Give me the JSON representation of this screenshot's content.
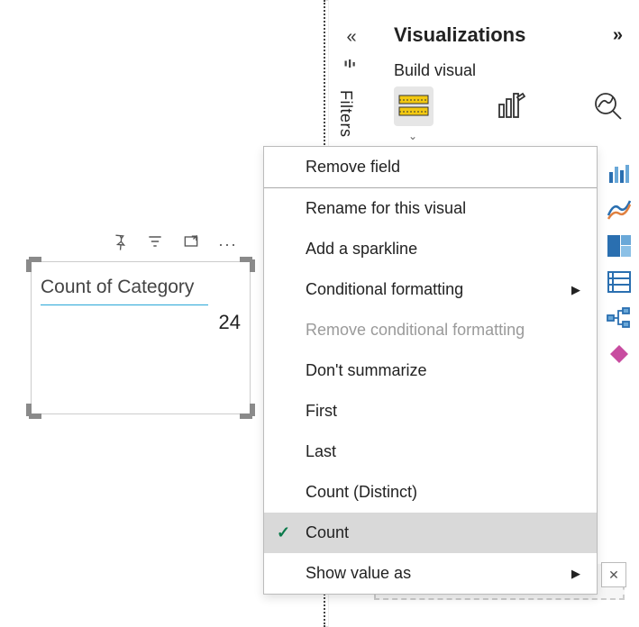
{
  "canvas": {
    "card": {
      "title": "Count of Category",
      "value": "24"
    }
  },
  "toolbar": {
    "pin_icon": "pin-icon",
    "filter_icon": "filter-icon",
    "focus_icon": "focus-mode-icon",
    "more_icon": "more-options-icon"
  },
  "panel": {
    "filters_label": "Filters",
    "title": "Visualizations",
    "build_label": "Build visual",
    "modes": {
      "build": "build-visual-icon",
      "format": "format-visual-icon",
      "analytics": "analytics-icon"
    }
  },
  "viz_gallery": [
    "clustered-column-chart-icon",
    "ribbon-chart-icon",
    "treemap-icon",
    "card-list-icon",
    "decomposition-tree-icon",
    "diamond-icon"
  ],
  "context_menu": {
    "items": [
      {
        "label": "Remove field",
        "type": "normal"
      },
      {
        "label": "Rename for this visual",
        "type": "normal"
      },
      {
        "label": "Add a sparkline",
        "type": "normal"
      },
      {
        "label": "Conditional formatting",
        "type": "submenu"
      },
      {
        "label": "Remove conditional formatting",
        "type": "disabled"
      },
      {
        "label": "Don't summarize",
        "type": "normal"
      },
      {
        "label": "First",
        "type": "normal"
      },
      {
        "label": "Last",
        "type": "normal"
      },
      {
        "label": "Count (Distinct)",
        "type": "normal"
      },
      {
        "label": "Count",
        "type": "selected"
      },
      {
        "label": "Show value as",
        "type": "submenu"
      }
    ]
  }
}
